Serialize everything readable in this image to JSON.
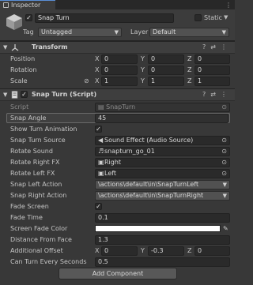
{
  "tab": {
    "label": "Inspector",
    "menu": "⋮"
  },
  "object": {
    "name": "Snap Turn",
    "active": true,
    "static_label": "Static",
    "tag_label": "Tag",
    "tag_value": "Untagged",
    "layer_label": "Layer",
    "layer_value": "Default"
  },
  "transform": {
    "title": "Transform",
    "rows": [
      {
        "label": "Position",
        "x": "0",
        "y": "0",
        "z": "0"
      },
      {
        "label": "Rotation",
        "x": "0",
        "y": "0",
        "z": "0"
      },
      {
        "label": "Scale",
        "x": "1",
        "y": "1",
        "z": "1"
      }
    ]
  },
  "snapturn": {
    "title": "Snap Turn (Script)",
    "script_label": "Script",
    "script_value": "SnapTurn",
    "rows": {
      "snap_angle": {
        "label": "Snap Angle",
        "value": "45"
      },
      "show_anim": {
        "label": "Show Turn Animation",
        "value": "✓"
      },
      "source": {
        "label": "Snap Turn Source",
        "value": "Sound Effect (Audio Source)"
      },
      "sound": {
        "label": "Rotate Sound",
        "value": "snapturn_go_01"
      },
      "right_fx": {
        "label": "Rotate Right FX",
        "value": "Right"
      },
      "left_fx": {
        "label": "Rotate Left FX",
        "value": "Left"
      },
      "left_action": {
        "label": "Snap Left Action",
        "value": "\\actions\\default\\in\\SnapTurnLeft"
      },
      "right_action": {
        "label": "Snap Right Action",
        "value": "\\actions\\default\\in\\SnapTurnRight"
      },
      "fade_screen": {
        "label": "Fade Screen",
        "value": "✓"
      },
      "fade_time": {
        "label": "Fade Time",
        "value": "0.1"
      },
      "fade_color": {
        "label": "Screen Fade Color",
        "value": "#ffffff"
      },
      "distance": {
        "label": "Distance From Face",
        "value": "1.3"
      },
      "offset": {
        "label": "Additional Offset",
        "x": "0",
        "y": "-0.3",
        "z": "0"
      },
      "can_turn": {
        "label": "Can Turn Every Seconds",
        "value": "0.5"
      }
    }
  },
  "add_component": "Add Component",
  "axes": {
    "x": "X",
    "y": "Y",
    "z": "Z"
  },
  "icons": {
    "help": "?",
    "presets": "⇄",
    "more": "⋮",
    "link": "⊘",
    "picker": "⊙",
    "dropdown": "▼",
    "fold_open": "▼",
    "check": "✓"
  }
}
